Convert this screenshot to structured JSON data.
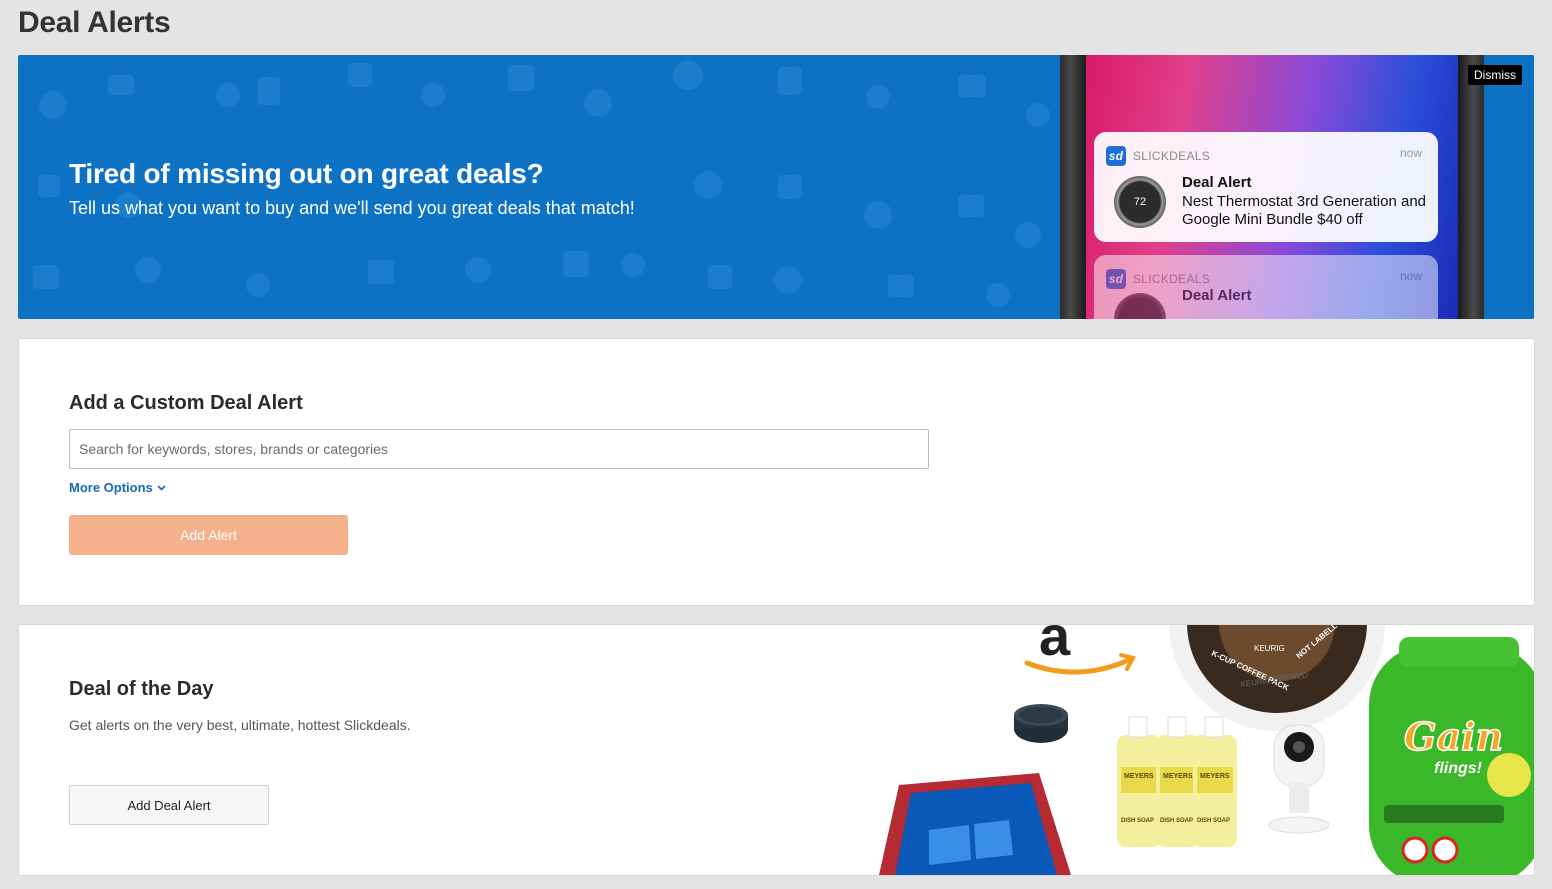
{
  "page": {
    "title": "Deal Alerts"
  },
  "hero": {
    "heading": "Tired of missing out on great deals?",
    "subtext": "Tell us what you want to buy and we'll send you great deals that match!",
    "dismiss_label": "Dismiss",
    "notification": {
      "app_name": "SLICKDEALS",
      "app_logo": "sd",
      "time": "now",
      "thermostat_reading": "72",
      "title": "Deal Alert",
      "body": "Nest Thermostat 3rd Generation and Google Mini Bundle $40 off"
    },
    "notification_2": {
      "app_name": "SLICKDEALS",
      "app_logo": "sd",
      "time": "now",
      "title": "Deal Alert"
    }
  },
  "custom_alert": {
    "title": "Add a Custom Deal Alert",
    "search_placeholder": "Search for keywords, stores, brands or categories",
    "search_value": "",
    "more_options_label": "More Options",
    "add_button_label": "Add Alert"
  },
  "deal_of_day": {
    "title": "Deal of the Day",
    "description": "Get alerts on the very best, ultimate, hottest Slickdeals.",
    "button_label": "Add Deal Alert",
    "product_art": {
      "amazon_logo": "a",
      "kcup_ring": "K-CUP COFFEE PACK",
      "kcup_brand": "KEURIG",
      "kcup_bottom": "KEURIG BREWED",
      "kcup_right": "NOT LABELL",
      "soap_brand": "MEYERS",
      "soap_type": "DISH SOAP",
      "gain_brand": "Gain",
      "gain_product": "flings!"
    }
  },
  "colors": {
    "hero_blue": "#0e72c4",
    "accent_orange": "#f5b08c",
    "link_blue": "#1a69b5"
  }
}
